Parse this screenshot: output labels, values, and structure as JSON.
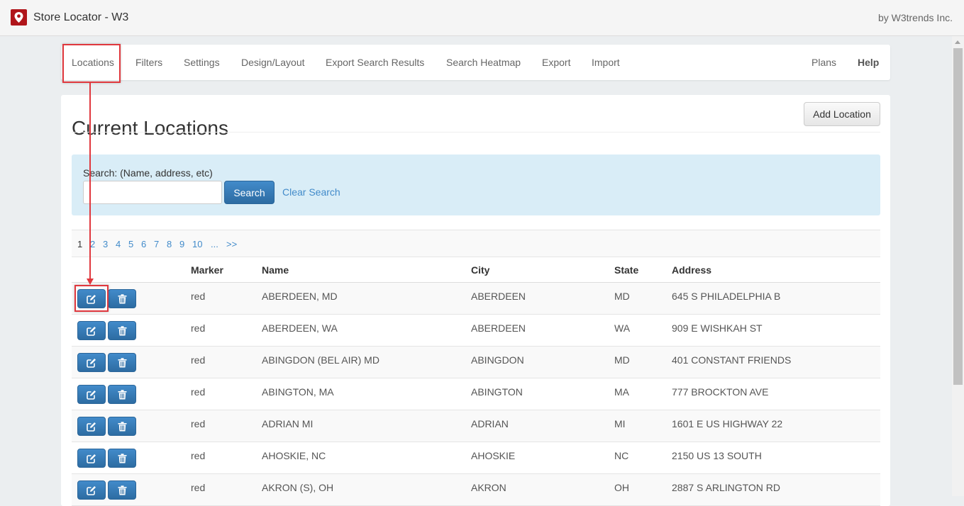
{
  "app": {
    "title": "Store Locator - W3",
    "vendor": "by W3trends Inc."
  },
  "nav": {
    "items": [
      "Locations",
      "Filters",
      "Settings",
      "Design/Layout",
      "Export Search Results",
      "Search Heatmap",
      "Export",
      "Import"
    ],
    "right": [
      "Plans",
      "Help"
    ],
    "active": "Locations"
  },
  "page": {
    "title": "Current Locations",
    "add_button": "Add Location"
  },
  "search": {
    "label": "Search: (Name, address, etc)",
    "value": "",
    "button": "Search",
    "clear": "Clear Search"
  },
  "pagination": [
    "1",
    "2",
    "3",
    "4",
    "5",
    "6",
    "7",
    "8",
    "9",
    "10",
    "...",
    ">>"
  ],
  "table": {
    "headers": [
      "Marker",
      "Name",
      "City",
      "State",
      "Address"
    ],
    "rows": [
      [
        "red",
        "ABERDEEN, MD",
        "ABERDEEN",
        "MD",
        "645 S PHILADELPHIA B"
      ],
      [
        "red",
        "ABERDEEN, WA",
        "ABERDEEN",
        "WA",
        "909 E WISHKAH ST"
      ],
      [
        "red",
        "ABINGDON (BEL AIR) MD",
        "ABINGDON",
        "MD",
        "401 CONSTANT FRIENDS"
      ],
      [
        "red",
        "ABINGTON, MA",
        "ABINGTON",
        "MA",
        "777 BROCKTON AVE"
      ],
      [
        "red",
        "ADRIAN MI",
        "ADRIAN",
        "MI",
        "1601 E US HIGHWAY 22"
      ],
      [
        "red",
        "AHOSKIE, NC",
        "AHOSKIE",
        "NC",
        "2150 US 13 SOUTH"
      ],
      [
        "red",
        "AKRON (S), OH",
        "AKRON",
        "OH",
        "2887 S ARLINGTON RD"
      ]
    ]
  },
  "colors": {
    "primary": "#428bca",
    "highlight": "#e0383e",
    "search_bg": "#d9edf7"
  }
}
